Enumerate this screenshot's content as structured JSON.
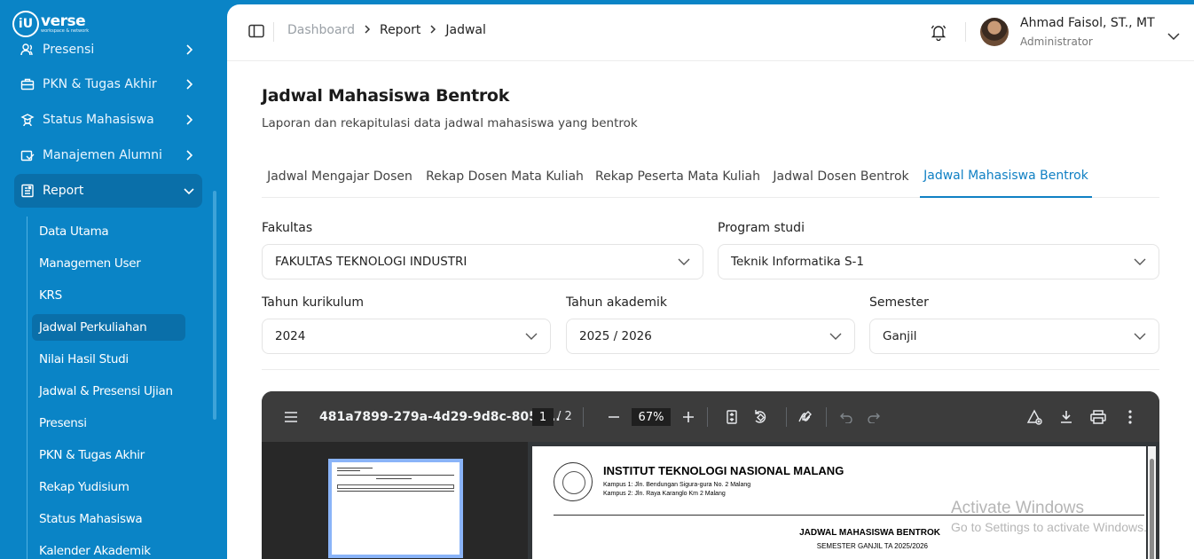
{
  "brand": {
    "logo_mark": "iU",
    "name": "verse",
    "tagline": "workspace & network"
  },
  "sidebar": {
    "items": [
      {
        "label": "Presensi",
        "icon": "users-icon"
      },
      {
        "label": "PKN & Tugas Akhir",
        "icon": "briefcase-icon"
      },
      {
        "label": "Status Mahasiswa",
        "icon": "student-icon"
      },
      {
        "label": "Manajemen Alumni",
        "icon": "graduation-icon"
      },
      {
        "label": "Report",
        "icon": "report-icon"
      }
    ],
    "report_sub": [
      "Data Utama",
      "Managemen User",
      "KRS",
      "Jadwal Perkuliahan",
      "Nilai Hasil Studi",
      "Jadwal & Presensi Ujian",
      "Presensi",
      "PKN & Tugas Akhir",
      "Rekap Yudisium",
      "Status Mahasiswa",
      "Kalender Akademik"
    ]
  },
  "header": {
    "breadcrumb": [
      "Dashboard",
      "Report",
      "Jadwal"
    ],
    "user_name": "Ahmad Faisol, ST., MT",
    "user_role": "Administrator"
  },
  "page": {
    "title": "Jadwal Mahasiswa Bentrok",
    "subtitle": "Laporan dan rekapitulasi data jadwal mahasiswa yang bentrok"
  },
  "tabs": [
    "Jadwal Mengajar Dosen",
    "Rekap Dosen Mata Kuliah",
    "Rekap Peserta Mata Kuliah",
    "Jadwal Dosen Bentrok",
    "Jadwal Mahasiswa Bentrok"
  ],
  "filters": {
    "fakultas": {
      "label": "Fakultas",
      "value": "FAKULTAS TEKNOLOGI INDUSTRI"
    },
    "prodi": {
      "label": "Program studi",
      "value": "Teknik Informatika S-1"
    },
    "kurikulum": {
      "label": "Tahun kurikulum",
      "value": "2024"
    },
    "akademik": {
      "label": "Tahun akademik",
      "value": "2025 / 2026"
    },
    "semester": {
      "label": "Semester",
      "value": "Ganjil"
    }
  },
  "pdf": {
    "filename": "481a7899-279a-4d29-9d8c-8050...",
    "page": "1",
    "page_total": "/ 2",
    "zoom": "67%",
    "doc": {
      "institution": "INSTITUT TEKNOLOGI NASIONAL MALANG",
      "address1": "Kampus 1: Jln. Bendungan Sigura-gura No. 2 Malang",
      "address2": "Kampus 2: Jln. Raya Karanglo Km 2 Malang",
      "title": "JADWAL MAHASISWA BENTROK",
      "subtitle": "SEMESTER GANJIL TA 2025/2026"
    }
  },
  "watermark": {
    "line1": "Activate Windows",
    "line2": "Go to Settings to activate Windows."
  }
}
